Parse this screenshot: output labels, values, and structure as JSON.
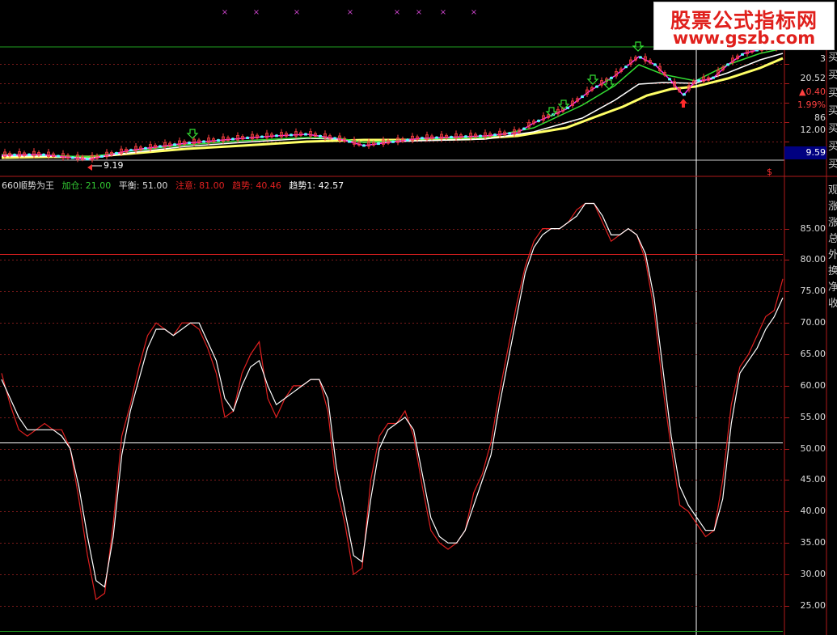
{
  "colors": {
    "background": "#000000",
    "grid": "#7a1a1a",
    "axis": "#b01a1a",
    "white_line": "#ffffff",
    "red_line": "#e02020",
    "yellow_ma": "#ffff66",
    "green_ma": "#33dd33",
    "magenta_ma": "#ff33ff",
    "accent_blue": "#000080"
  },
  "legend": {
    "name": "660顺势为王",
    "add_label": "加仓:",
    "add_value": "21.00",
    "balance_label": "平衡:",
    "balance_value": "51.00",
    "caution_label": "注意:",
    "caution_value": "81.00",
    "trend_label": "趋势:",
    "trend_value": "40.46",
    "trend1_label": "趋势1:",
    "trend1_value": "42.57"
  },
  "watermark": {
    "title": "股票公式指标网",
    "url": "www.gszb.com"
  },
  "price_panel": {
    "right_values": [
      "3",
      "20.52",
      "▲0.40",
      "1.99%",
      "86",
      "12.00"
    ],
    "current_price_box": "9.59",
    "low_marker": "9.19",
    "dollar_mark": "$",
    "side_chars": [
      "买",
      "买",
      "买",
      "买",
      "买",
      "买",
      "买"
    ],
    "x_markers": [
      "×",
      "×",
      "×",
      "×",
      "×",
      "×",
      "×",
      "×"
    ],
    "green_arrow_icon": "arrow-down-icon",
    "red_arrow_icon": "arrow-up-icon"
  },
  "indicator_side_chars": [
    "观",
    "涨",
    "涨",
    "总",
    "外",
    "换",
    "净",
    "收"
  ],
  "chart_data": {
    "type": "line",
    "yticks": [
      25,
      30,
      35,
      40,
      45,
      50,
      55,
      60,
      65,
      70,
      75,
      80,
      85
    ],
    "ytick_labels": [
      "25.00",
      "30.00",
      "35.00",
      "40.00",
      "45.00",
      "50.00",
      "55.00",
      "60.00",
      "65.00",
      "70.00",
      "75.00",
      "80.00",
      "85.00"
    ],
    "ylim": [
      21,
      91
    ],
    "reference_lines": [
      {
        "name": "加仓",
        "value": 21
      },
      {
        "name": "平衡",
        "value": 51
      },
      {
        "name": "注意",
        "value": 81
      }
    ],
    "x_count": 100,
    "series": [
      {
        "name": "趋势",
        "color": "#e02020",
        "values": [
          62,
          57,
          53,
          52,
          53,
          54,
          53,
          53,
          50,
          42,
          33,
          26,
          27,
          38,
          52,
          57,
          63,
          68,
          70,
          69,
          68,
          70,
          70,
          69,
          66,
          62,
          55,
          56,
          62,
          65,
          67,
          58,
          55,
          58,
          60,
          60,
          61,
          61,
          56,
          44,
          38,
          30,
          31,
          45,
          52,
          54,
          54,
          56,
          52,
          44,
          37,
          35,
          34,
          35,
          37,
          43,
          46,
          51,
          59,
          66,
          73,
          79,
          83,
          85,
          85,
          85,
          86,
          88,
          89,
          89,
          86,
          83,
          84,
          85,
          84,
          80,
          72,
          60,
          50,
          41,
          40,
          38,
          36,
          37,
          45,
          57,
          63,
          65,
          68,
          71,
          72,
          77
        ]
      },
      {
        "name": "趋势1",
        "color": "#ffffff",
        "values": [
          61,
          58,
          55,
          53,
          53,
          53,
          53,
          52,
          50,
          44,
          36,
          29,
          28,
          36,
          49,
          56,
          61,
          66,
          69,
          69,
          68,
          69,
          70,
          70,
          67,
          64,
          58,
          56,
          60,
          63,
          64,
          60,
          57,
          58,
          59,
          60,
          61,
          61,
          58,
          47,
          40,
          33,
          32,
          42,
          50,
          53,
          54,
          55,
          53,
          46,
          39,
          36,
          35,
          35,
          37,
          41,
          45,
          49,
          57,
          64,
          71,
          78,
          82,
          84,
          85,
          85,
          86,
          87,
          89,
          89,
          87,
          84,
          84,
          85,
          84,
          81,
          74,
          63,
          52,
          44,
          41,
          39,
          37,
          37,
          42,
          54,
          62,
          64,
          66,
          69,
          71,
          74
        ]
      }
    ]
  }
}
